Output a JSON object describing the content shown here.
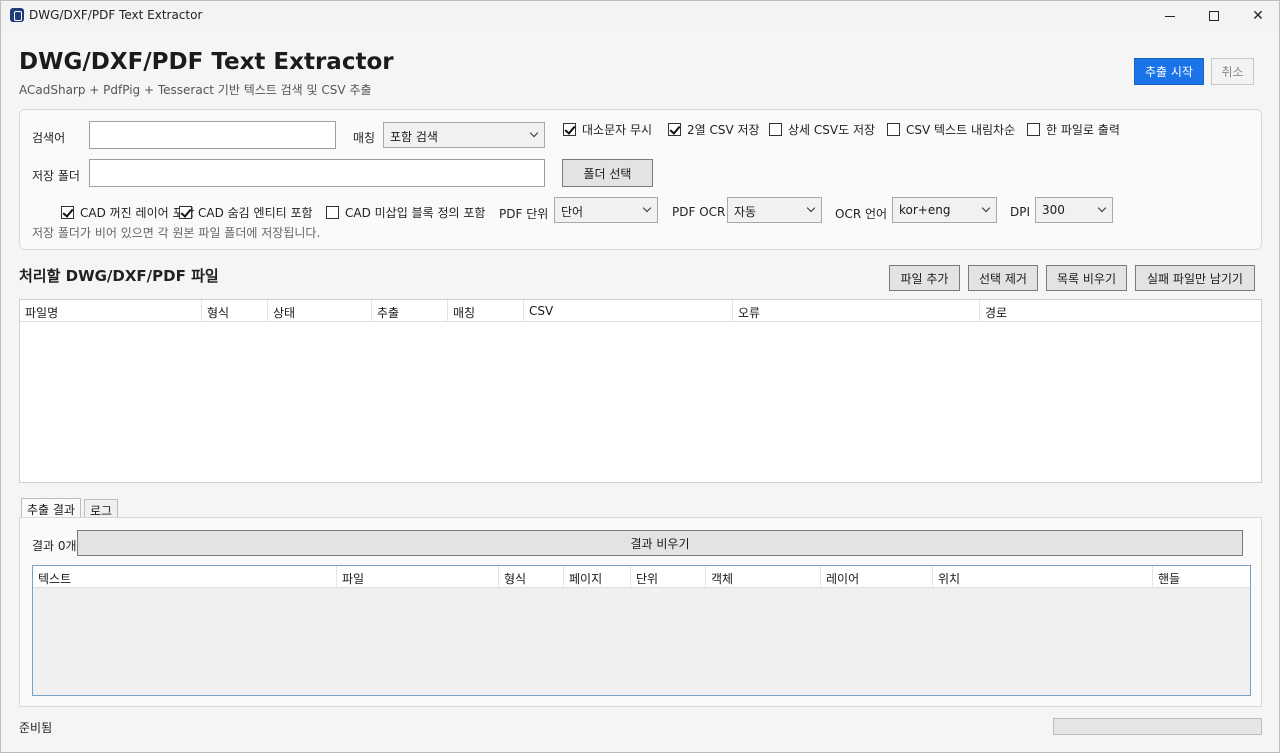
{
  "window": {
    "title": "DWG/DXF/PDF Text Extractor",
    "minimize": "—",
    "maximize": "□",
    "close": "✕"
  },
  "header": {
    "title": "DWG/DXF/PDF Text Extractor",
    "subtitle": "ACadSharp + PdfPig + Tesseract 기반 텍스트 검색 및 CSV 추출",
    "start_label": "추출 시작",
    "cancel_label": "취소"
  },
  "options": {
    "search_label": "검색어",
    "search_value": "",
    "match_label": "매칭",
    "match_value": "포함 검색",
    "ignore_case": {
      "label": "대소문자 무시",
      "checked": true
    },
    "two_col_csv": {
      "label": "2열 CSV 저장",
      "checked": true
    },
    "detail_csv": {
      "label": "상세 CSV도 저장",
      "checked": false
    },
    "csv_sort_desc": {
      "label": "CSV 텍스트 내림차순",
      "checked": false
    },
    "single_file": {
      "label": "한 파일로 출력",
      "checked": false
    },
    "folder_label": "저장 폴더",
    "folder_value": "",
    "folder_button": "폴더 선택",
    "cad_off_layers": {
      "label": "CAD 꺼진 레이어 포함",
      "checked": true
    },
    "cad_hidden_entities": {
      "label": "CAD 숨김 엔티티 포함",
      "checked": true
    },
    "cad_unused_blocks": {
      "label": "CAD 미삽입 블록 정의 포함",
      "checked": false
    },
    "pdf_unit_label": "PDF 단위",
    "pdf_unit_value": "단어",
    "pdf_ocr_label": "PDF OCR",
    "pdf_ocr_value": "자동",
    "ocr_lang_label": "OCR 언어",
    "ocr_lang_value": "kor+eng",
    "dpi_label": "DPI",
    "dpi_value": "300",
    "hint": "저장 폴더가 비어 있으면 각 원본 파일 폴더에 저장됩니다."
  },
  "files": {
    "title": "처리할 DWG/DXF/PDF 파일",
    "buttons": {
      "add": "파일 추가",
      "remove": "선택 제거",
      "clear": "목록 비우기",
      "keep_failed": "실패 파일만 남기기"
    },
    "columns": [
      "파일명",
      "형식",
      "상태",
      "추출",
      "매칭",
      "CSV",
      "오류",
      "경로"
    ]
  },
  "results": {
    "tabs": [
      "추출 결과",
      "로그"
    ],
    "count_label": "결과 0개",
    "clear_button": "결과 비우기",
    "columns": [
      "텍스트",
      "파일",
      "형식",
      "페이지",
      "단위",
      "객체",
      "레이어",
      "위치",
      "핸들"
    ]
  },
  "status": {
    "text": "준비됨",
    "progress": 0
  }
}
